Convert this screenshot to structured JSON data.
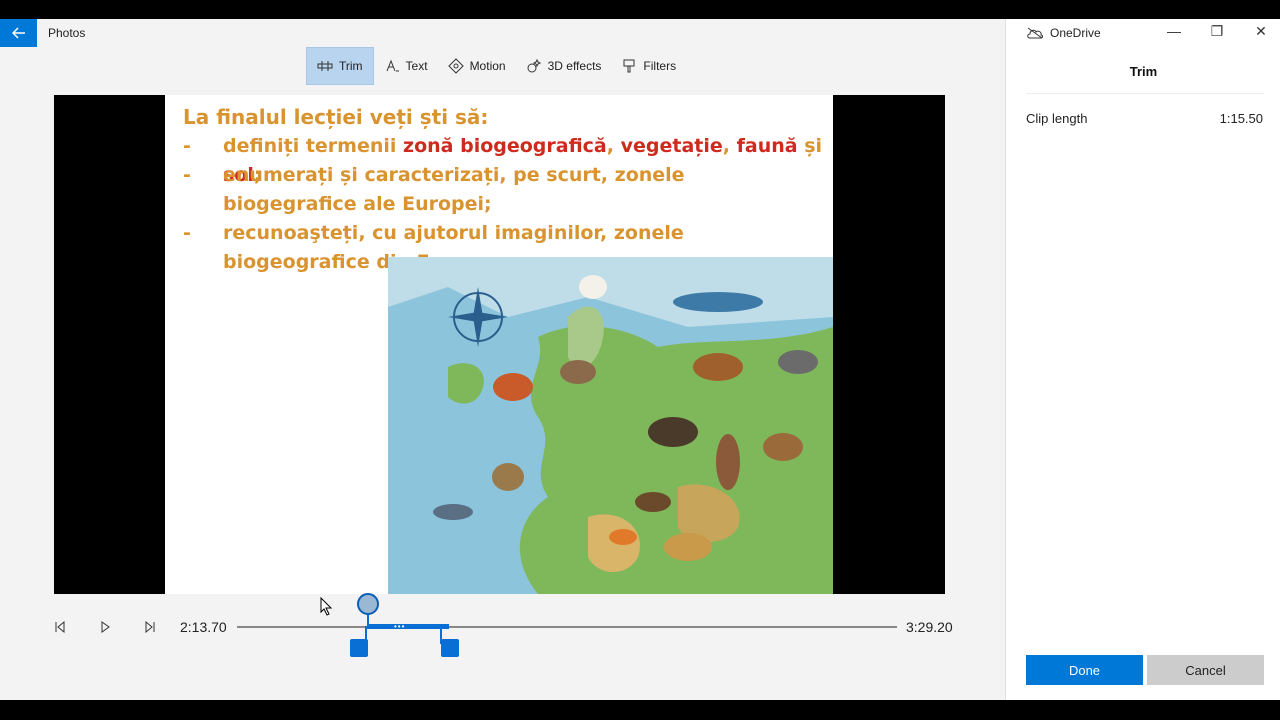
{
  "app": {
    "title": "Photos",
    "back_icon": "back-arrow-icon"
  },
  "toolbar": {
    "items": [
      {
        "label": "Trim",
        "icon": "trim-icon",
        "active": true
      },
      {
        "label": "Text",
        "icon": "text-icon",
        "active": false
      },
      {
        "label": "Motion",
        "icon": "motion-icon",
        "active": false
      },
      {
        "label": "3D effects",
        "icon": "3d-effects-icon",
        "active": false
      },
      {
        "label": "Filters",
        "icon": "filters-icon",
        "active": false
      }
    ]
  },
  "slide": {
    "title": "La finalul lecției veți ști să:",
    "bullets": [
      {
        "dash": "-",
        "prefix": "definiți termenii ",
        "t1": "zonă biogeografică",
        "s1": ", ",
        "t2": "vegetație",
        "s2": ", ",
        "t3": "faună",
        "s3": " și ",
        "t4": "sol",
        "s4": ";"
      },
      {
        "dash": "-",
        "text": "enumerați și caracterizați, pe scurt, zonele biogegrafice ale Europei;"
      },
      {
        "dash": "-",
        "text": "recunoaşteți, cu ajutorul imaginilor, zonele biogeografice din Europa."
      }
    ]
  },
  "playback": {
    "start_time": "2:13.70",
    "end_time": "3:29.20",
    "prev_frame_icon": "previous-frame-icon",
    "play_icon": "play-icon",
    "next_frame_icon": "next-frame-icon"
  },
  "window": {
    "onedrive_label": "OneDrive",
    "minimize": "—",
    "restore": "❐",
    "close": "✕"
  },
  "pane": {
    "title": "Trim",
    "clip_length_label": "Clip length",
    "clip_length_value": "1:15.50",
    "done_label": "Done",
    "cancel_label": "Cancel"
  },
  "colors": {
    "accent": "#0078d7",
    "slide_text": "#d99430",
    "slide_highlight": "#cc2b1d"
  }
}
